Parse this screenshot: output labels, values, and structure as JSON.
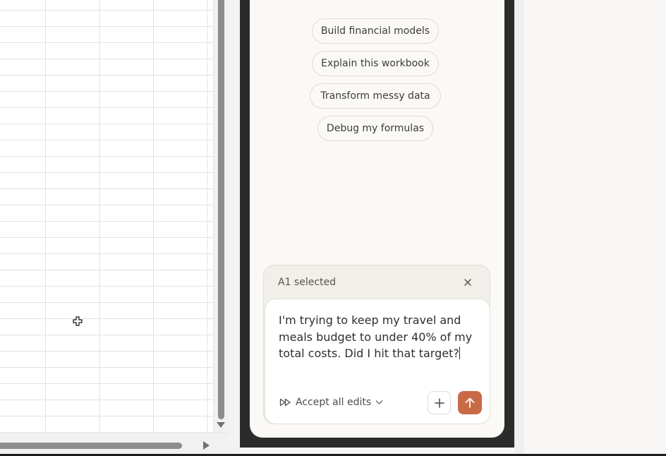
{
  "suggestions": [
    "Build financial models",
    "Explain this workbook",
    "Transform messy data",
    "Debug my formulas"
  ],
  "composer": {
    "selection_label": "A1 selected",
    "prompt": "I'm trying to keep my travel and meals budget to under 40% of my total costs. Did I hit that target?",
    "accept_label": "Accept all edits"
  },
  "icons": {
    "close": "close-icon",
    "fast_forward": "fast-forward-icon",
    "chevron": "chevron-down-icon",
    "add": "plus-icon",
    "send": "arrow-up-icon",
    "cursor": "cell-cursor-icon"
  },
  "colors": {
    "send_button": "#c96a47",
    "frame": "#2b2b2b",
    "panel": "#faf9f5"
  }
}
